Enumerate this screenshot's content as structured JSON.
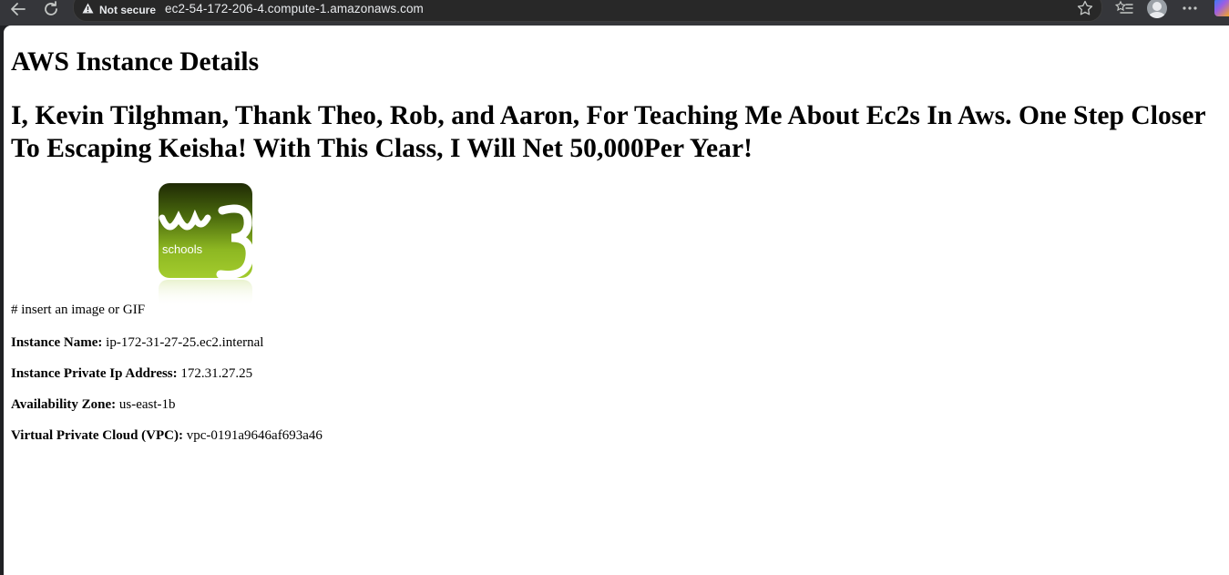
{
  "browser": {
    "security_label": "Not secure",
    "url": "ec2-54-172-206-4.compute-1.amazonaws.com",
    "icons": [
      "back-arrow-icon",
      "reload-icon",
      "warning-triangle-icon",
      "star-icon",
      "reading-list-icon",
      "profile-icon",
      "more-icon",
      "copilot-icon"
    ]
  },
  "page": {
    "heading": "AWS Instance Details",
    "subheading": "I, Kevin Tilghman, Thank Theo, Rob, and Aaron, For Teaching Me About Ec2s In Aws. One Step Closer To Escaping Keisha! With This Class, I Will Net 50,000Per Year!",
    "image_caption": "# insert an image or GIF",
    "logo_text": "schools",
    "fields": [
      {
        "label": "Instance Name:",
        "value": "ip-172-31-27-25.ec2.internal"
      },
      {
        "label": "Instance Private Ip Address:",
        "value": "172.31.27.25"
      },
      {
        "label": "Availability Zone:",
        "value": "us-east-1b"
      },
      {
        "label": "Virtual Private Cloud (VPC):",
        "value": "vpc-0191a9646af693a46"
      }
    ]
  },
  "colors": {
    "chrome_bg": "#35363a",
    "logo_top": "#1f2a05",
    "logo_bottom": "#9bc32a"
  }
}
